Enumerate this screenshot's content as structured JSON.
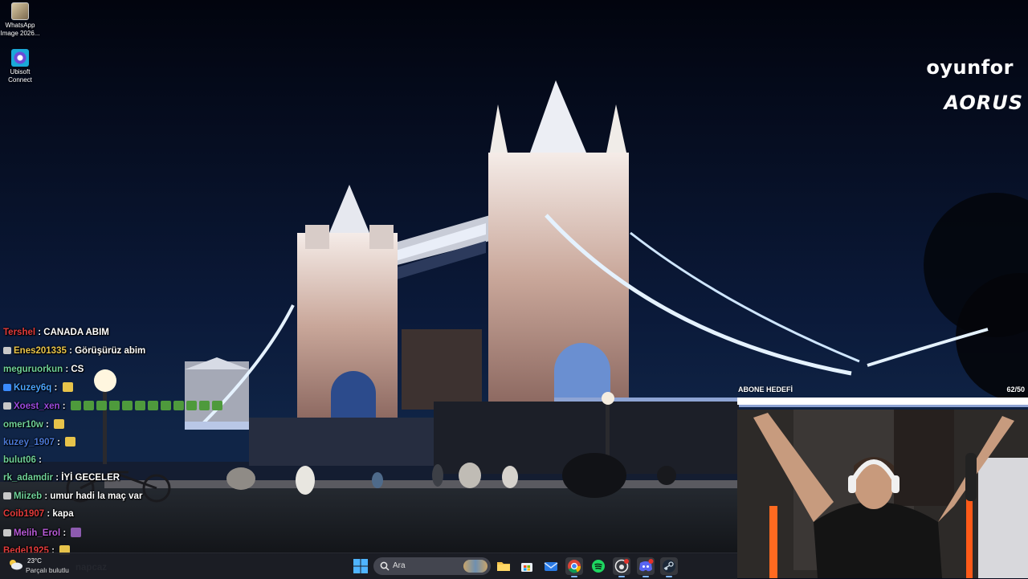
{
  "desktop": {
    "icons": [
      {
        "label_line1": "WhatsApp",
        "label_line2": "Image 2026..."
      },
      {
        "label_line1": "Ubisoft",
        "label_line2": "Connect"
      }
    ]
  },
  "overlay": {
    "brand_top": "oyunfor",
    "brand_bottom": "AORUS"
  },
  "chat": {
    "messages": [
      {
        "user": "Tershel",
        "text": "CANADA ABIM",
        "color": "#e23b3b"
      },
      {
        "user": "Enes201335",
        "text": "Görüşürüz abim",
        "color": "#e8c44a"
      },
      {
        "user": "meguruorkun",
        "text": "CS",
        "color": "#6fd19a"
      },
      {
        "user": "Kuzey6q",
        "text": "",
        "color": "#4aa3ff"
      },
      {
        "user": "Xoest_xen",
        "text": "",
        "color": "#9b4be0"
      },
      {
        "user": "omer10w",
        "text": "",
        "color": "#6fd19a"
      },
      {
        "user": "kuzey_1907",
        "text": "",
        "color": "#4a78d6"
      },
      {
        "user": "bulut06",
        "text": "",
        "color": "#6fd19a"
      },
      {
        "user": "rk_adamdir",
        "text": "İYİ GECELER",
        "color": "#6fd19a"
      },
      {
        "user": "Miizeb",
        "text": "umur hadi la maç var",
        "color": "#6fd19a"
      },
      {
        "user": "Coib1907",
        "text": "kapa",
        "color": "#e23b3b"
      },
      {
        "user": "Melih_Erol",
        "text": "",
        "color": "#b85bd8"
      },
      {
        "user": "Bedel1925",
        "text": "",
        "color": "#e23b3b"
      },
      {
        "user": "",
        "text": "napcaz",
        "color": "#6fd19a"
      }
    ]
  },
  "sub_goal": {
    "label": "ABONE HEDEFİ",
    "count": "62/50",
    "progress": 1.0
  },
  "taskbar": {
    "weather_temp": "23°C",
    "weather_desc": "Parçalı bulutlu",
    "search_placeholder": "Ara",
    "apps": [
      "file-explorer",
      "microsoft-store",
      "mail",
      "chrome",
      "spotify",
      "github-desktop",
      "discord",
      "steam"
    ]
  },
  "colors": {
    "sky": "#050a1c",
    "bridge_light": "#f4e6de",
    "cable_light": "#d8ecff",
    "taskbar_bg": "#1c1e26"
  }
}
